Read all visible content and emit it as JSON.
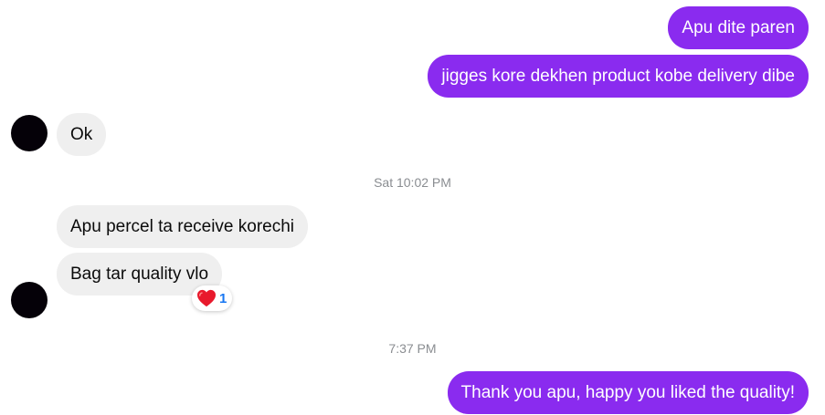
{
  "messages": [
    {
      "direction": "outgoing",
      "text": "Apu dite paren"
    },
    {
      "direction": "outgoing",
      "text": "jigges kore dekhen product kobe delivery dibe"
    },
    {
      "direction": "incoming",
      "text": "Ok"
    },
    {
      "direction": "incoming",
      "text": "Apu percel ta receive korechi"
    },
    {
      "direction": "incoming",
      "text": "Bag tar quality vlo"
    },
    {
      "direction": "outgoing",
      "text": "Thank you apu, happy you liked the quality!"
    }
  ],
  "timestamps": [
    "Sat 10:02 PM",
    "7:37 PM"
  ],
  "reaction": {
    "emoji": "heart-icon",
    "count": "1",
    "count_color": "#1877f2"
  },
  "colors": {
    "outgoing_bubble": "#8a2bef",
    "incoming_bubble": "#efefef",
    "timestamp_text": "#8a8d91",
    "avatar": "#050108"
  }
}
